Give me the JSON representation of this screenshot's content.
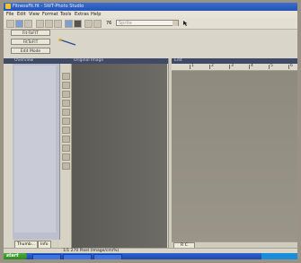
{
  "window": {
    "title": "FitnessFit.fit - SWT-Photo Studio"
  },
  "menu": [
    "File",
    "Edit",
    "View",
    "Format",
    "Tools",
    "Extras",
    "Help"
  ],
  "toolbar": {
    "zoom_label": "76",
    "combo_value": "Sprite"
  },
  "left_buttons": [
    "Fit-ToFIT",
    "FitToFIT",
    "Edit Mode"
  ],
  "panel_headers": {
    "left": "Overview",
    "middle": "Original Image",
    "right": "Edit"
  },
  "left_tabs": [
    "Thumb...",
    "Info"
  ],
  "right_ruler": [
    "1",
    "2",
    "3",
    "4",
    "5",
    "6"
  ],
  "right_tab": "R C",
  "status": "1/1 270 Pixel (Image/cm/%)",
  "taskbar": {
    "start": "start"
  },
  "colors": {
    "titlebar": "#2451b4",
    "canvas": "#5b5a55",
    "workspace": "#8e8a7e"
  }
}
